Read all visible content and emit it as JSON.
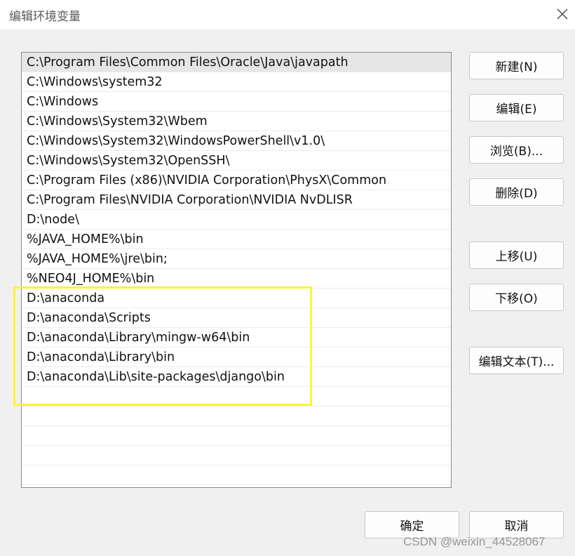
{
  "window": {
    "title": "编辑环境变量",
    "close_icon": "close-icon"
  },
  "path_list": {
    "items": [
      "C:\\Program Files\\Common Files\\Oracle\\Java\\javapath",
      "C:\\Windows\\system32",
      "C:\\Windows",
      "C:\\Windows\\System32\\Wbem",
      "C:\\Windows\\System32\\WindowsPowerShell\\v1.0\\",
      "C:\\Windows\\System32\\OpenSSH\\",
      "C:\\Program Files (x86)\\NVIDIA Corporation\\PhysX\\Common",
      "C:\\Program Files\\NVIDIA Corporation\\NVIDIA NvDLISR",
      "D:\\node\\",
      "%JAVA_HOME%\\bin",
      "%JAVA_HOME%\\jre\\bin;",
      "%NEO4J_HOME%\\bin",
      "D:\\anaconda",
      "D:\\anaconda\\Scripts",
      "D:\\anaconda\\Library\\mingw-w64\\bin",
      "D:\\anaconda\\Library\\bin",
      "D:\\anaconda\\Lib\\site-packages\\django\\bin",
      "",
      "",
      "",
      "",
      ""
    ],
    "selected_index": 0
  },
  "buttons": {
    "new": "新建(N)",
    "edit": "编辑(E)",
    "browse": "浏览(B)...",
    "delete": "删除(D)",
    "move_up": "上移(U)",
    "move_down": "下移(O)",
    "edit_text": "编辑文本(T)...",
    "ok": "确定",
    "cancel": "取消"
  },
  "annotation": {
    "highlight_color": "#fff33a"
  },
  "watermark": "CSDN @weixin_44528067"
}
